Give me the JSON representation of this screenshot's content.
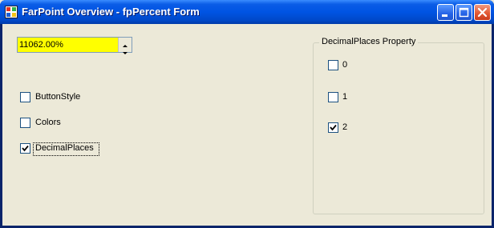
{
  "window": {
    "title": "FarPoint Overview - fpPercent Form",
    "icons": [
      "app-icon",
      "minimize-icon",
      "maximize-icon",
      "close-icon"
    ]
  },
  "percent_field": {
    "value": "11062.00%",
    "background_color": "#FFFF00"
  },
  "options": [
    {
      "label": "ButtonStyle",
      "checked": false
    },
    {
      "label": "Colors",
      "checked": false
    },
    {
      "label": "DecimalPlaces",
      "checked": true
    }
  ],
  "decimal_places_group": {
    "label": "DecimalPlaces Property",
    "items": [
      {
        "label": "0",
        "checked": false
      },
      {
        "label": "1",
        "checked": false
      },
      {
        "label": "2",
        "checked": true
      }
    ]
  }
}
